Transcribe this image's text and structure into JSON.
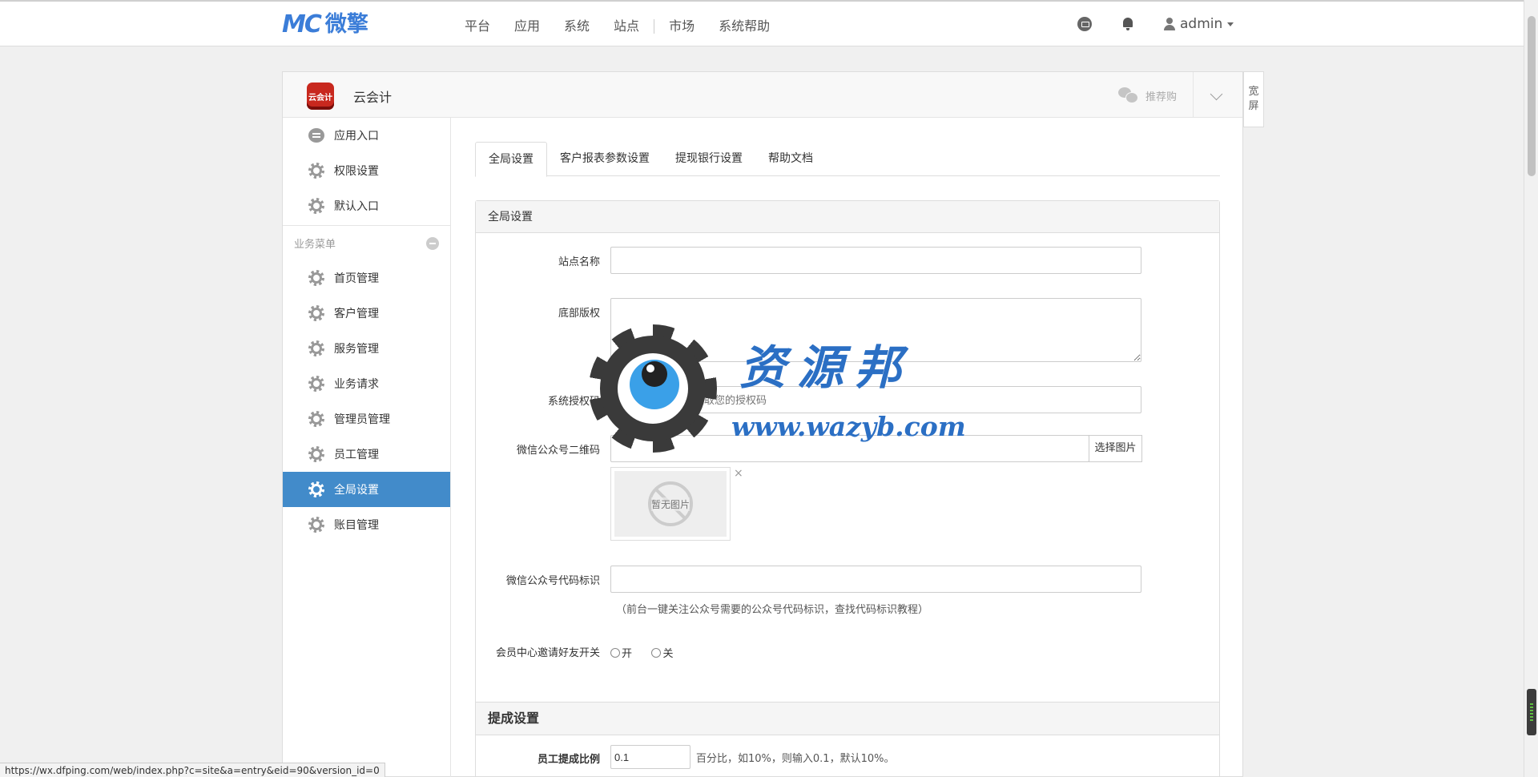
{
  "topbar": {
    "logo_mark": "MC",
    "logo_text": "微擎",
    "nav": [
      "平台",
      "应用",
      "系统",
      "站点",
      "市场",
      "系统帮助"
    ],
    "user": "admin"
  },
  "panel": {
    "app_logo": "云会计",
    "app_name": "云会计",
    "recommend": "推荐购",
    "wide_screen": [
      "宽",
      "屏"
    ]
  },
  "sidebar": {
    "top_items": [
      "应用入口",
      "权限设置",
      "默认入口"
    ],
    "group_label": "业务菜单",
    "items": [
      "首页管理",
      "客户管理",
      "服务管理",
      "业务请求",
      "管理员管理",
      "员工管理",
      "全局设置",
      "账目管理"
    ],
    "active_index": 6
  },
  "tabs": [
    "全局设置",
    "客户报表参数设置",
    "提现银行设置",
    "帮助文档"
  ],
  "form": {
    "box_title": "全局设置",
    "site_name_label": "站点名称",
    "site_name_value": "",
    "footer_label": "底部版权",
    "footer_value": "",
    "auth_code_label": "系统授权码",
    "auth_code_placeholder": "请联系开发者，获取您的授权码",
    "qrcode_label": "微信公众号二维码",
    "qrcode_button": "选择图片",
    "no_image": "暂无图片",
    "close_glyph": "×",
    "account_id_label": "微信公众号代码标识",
    "account_id_hint": "（前台一键关注公众号需要的公众号代码标识，查找代码标识教程）",
    "invite_label": "会员中心邀请好友开关",
    "invite_on": "开",
    "invite_off": "关",
    "commission_title": "提成设置",
    "staff_ratio_label": "员工提成比例",
    "staff_ratio_value": "0.1",
    "staff_ratio_hint": "百分比，如10%，则输入0.1，默认10%。"
  },
  "watermark": {
    "title": "资源邦",
    "url": "www.wazyb.com"
  },
  "status_url": "https://wx.dfping.com/web/index.php?c=site&a=entry&eid=90&version_id=0",
  "colors": {
    "accent": "#428bca",
    "brand": "#3b7dd8",
    "app_logo": "#c8281e"
  }
}
